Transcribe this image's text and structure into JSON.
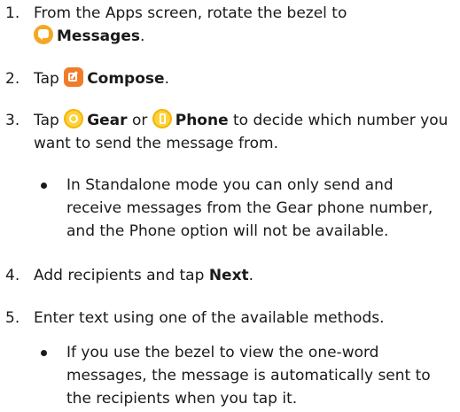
{
  "steps": [
    {
      "number": "1.",
      "text_before": "From the Apps screen, rotate the bezel to",
      "icon": "messages-icon",
      "bold": "Messages",
      "text_after": "."
    },
    {
      "number": "2.",
      "text_before": "Tap",
      "icon": "compose-icon",
      "bold": "Compose",
      "text_after": "."
    },
    {
      "number": "3.",
      "text_before": "Tap",
      "icon1": "gear-icon",
      "bold1": "Gear",
      "middle": "or",
      "icon2": "phone-icon",
      "bold2": "Phone",
      "text_after": "to decide which number you want to send the message from.",
      "bullet": "In Standalone mode you can only send and receive messages from the Gear phone number, and the Phone option will not be available."
    },
    {
      "number": "4.",
      "text_before": "Add recipients and tap",
      "bold": "Next",
      "text_after": "."
    },
    {
      "number": "5.",
      "text": "Enter text using one of the available methods.",
      "bullet": "If you use the bezel to view the one-word messages, the message is automatically sent to the recipients when you tap it."
    }
  ],
  "colors": {
    "text": "#1a1a1a",
    "messages_icon": "#f5a623",
    "compose_icon": "#f07c2a",
    "gear_phone_icon": "#ffd23a"
  }
}
